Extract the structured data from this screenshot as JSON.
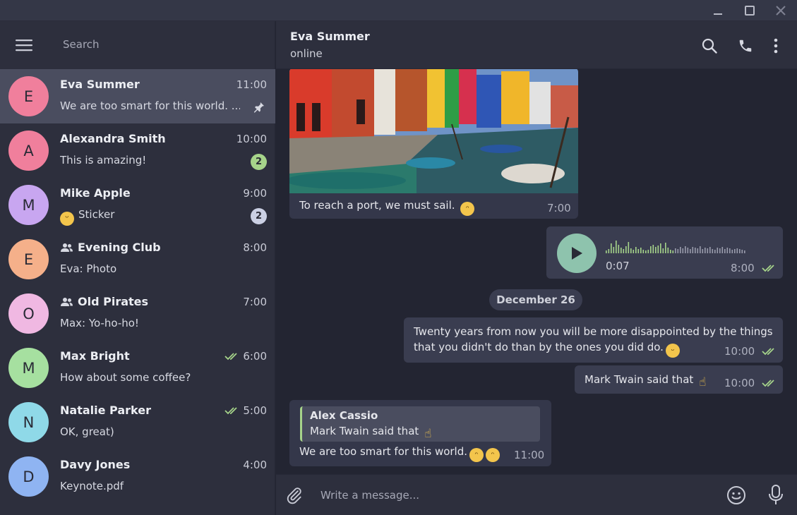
{
  "window": {
    "controls": [
      "minimize",
      "maximize",
      "close"
    ]
  },
  "sidebar": {
    "search_placeholder": "Search",
    "chats": [
      {
        "name": "Eva Summer",
        "initial": "E",
        "avatar_color": "#f07f9c",
        "time": "11:00",
        "preview": "We are too smart for this world. ...",
        "pinned": true
      },
      {
        "name": "Alexandra Smith",
        "initial": "A",
        "avatar_color": "#f07f9c",
        "time": "10:00",
        "preview": "This is amazing!",
        "unread": "2",
        "badge_color": "#a6d48a"
      },
      {
        "name": "Mike Apple",
        "initial": "M",
        "avatar_color": "#c8a6f0",
        "time": "9:00",
        "preview": "Sticker",
        "unread": "2",
        "badge_color": "#cbd0e4"
      },
      {
        "name": "Evening Club",
        "initial": "E",
        "avatar_color": "#f5b08a",
        "time": "8:00",
        "preview": "Eva: Photo",
        "group": true
      },
      {
        "name": "Old Pirates",
        "initial": "O",
        "avatar_color": "#f0b8e2",
        "time": "7:00",
        "preview": "Max: Yo-ho-ho!",
        "group": true
      },
      {
        "name": "Max Bright",
        "initial": "M",
        "avatar_color": "#a6e0a0",
        "time": "6:00",
        "preview": "How about some coffee?",
        "read": true
      },
      {
        "name": "Natalie Parker",
        "initial": "N",
        "avatar_color": "#8fd9e8",
        "time": "5:00",
        "preview": "OK, great)",
        "read": true
      },
      {
        "name": "Davy Jones",
        "initial": "D",
        "avatar_color": "#8fb4f2",
        "time": "4:00",
        "preview": "Keynote.pdf"
      }
    ]
  },
  "chat": {
    "peer_name": "Eva Summer",
    "peer_status": "online",
    "messages": {
      "photo": {
        "caption": "To reach a port, we must sail.",
        "time": "7:00"
      },
      "voice": {
        "duration": "0:07",
        "time": "8:00"
      },
      "date_separator": "December 26",
      "out1": {
        "line1": "Twenty years from now you will be more disappointed by the things",
        "line2": "that you didn't do than by the ones you did do.",
        "time": "10:00"
      },
      "out2": {
        "text": "Mark Twain said that",
        "time": "10:00"
      },
      "in_reply": {
        "reply_author": "Alex Cassio",
        "reply_text": "Mark Twain said that",
        "text": "We are too smart for this world.",
        "time": "11:00"
      }
    }
  },
  "composer": {
    "placeholder": "Write a message..."
  },
  "colors": {
    "accent_green": "#a6d48a",
    "play_button": "#8ec3ad",
    "background": "#232532",
    "panel": "#2d2f3d"
  }
}
